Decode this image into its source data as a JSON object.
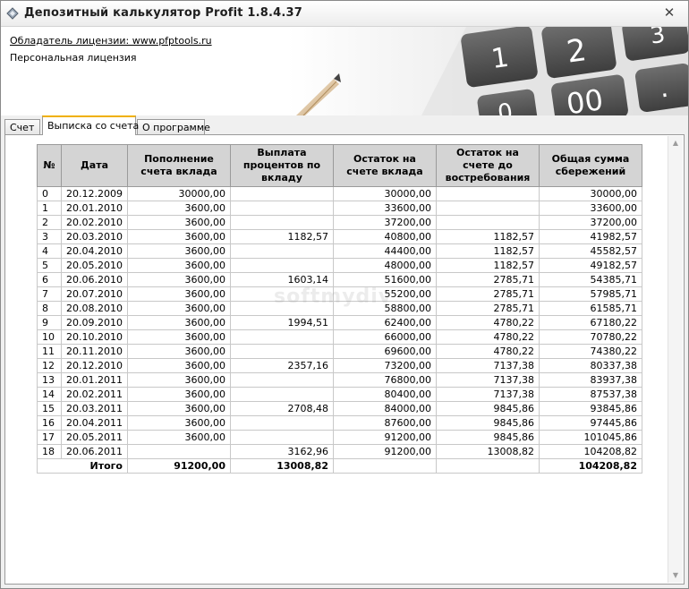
{
  "window": {
    "title": "Депозитный калькулятор Profit 1.8.4.37",
    "close_glyph": "✕"
  },
  "header": {
    "license_owner": "Обладатель лицензии: www.pfptools.ru",
    "license_type": "Персональная лицензия",
    "calc_keys": [
      "1",
      "2",
      "3",
      "0",
      "00",
      "."
    ]
  },
  "tabs": [
    {
      "label": "Счет",
      "active": false
    },
    {
      "label": "Выписка со счета",
      "active": true
    },
    {
      "label": "О программе",
      "active": false
    }
  ],
  "watermark": "softmydiv",
  "table": {
    "columns": [
      "№",
      "Дата",
      "Пополнение счета вклада",
      "Выплата процентов по вкладу",
      "Остаток на счете вклада",
      "Остаток на счете до востребования",
      "Общая сумма сбережений"
    ],
    "rows": [
      [
        "0",
        "20.12.2009",
        "30000,00",
        "",
        "30000,00",
        "",
        "30000,00"
      ],
      [
        "1",
        "20.01.2010",
        "3600,00",
        "",
        "33600,00",
        "",
        "33600,00"
      ],
      [
        "2",
        "20.02.2010",
        "3600,00",
        "",
        "37200,00",
        "",
        "37200,00"
      ],
      [
        "3",
        "20.03.2010",
        "3600,00",
        "1182,57",
        "40800,00",
        "1182,57",
        "41982,57"
      ],
      [
        "4",
        "20.04.2010",
        "3600,00",
        "",
        "44400,00",
        "1182,57",
        "45582,57"
      ],
      [
        "5",
        "20.05.2010",
        "3600,00",
        "",
        "48000,00",
        "1182,57",
        "49182,57"
      ],
      [
        "6",
        "20.06.2010",
        "3600,00",
        "1603,14",
        "51600,00",
        "2785,71",
        "54385,71"
      ],
      [
        "7",
        "20.07.2010",
        "3600,00",
        "",
        "55200,00",
        "2785,71",
        "57985,71"
      ],
      [
        "8",
        "20.08.2010",
        "3600,00",
        "",
        "58800,00",
        "2785,71",
        "61585,71"
      ],
      [
        "9",
        "20.09.2010",
        "3600,00",
        "1994,51",
        "62400,00",
        "4780,22",
        "67180,22"
      ],
      [
        "10",
        "20.10.2010",
        "3600,00",
        "",
        "66000,00",
        "4780,22",
        "70780,22"
      ],
      [
        "11",
        "20.11.2010",
        "3600,00",
        "",
        "69600,00",
        "4780,22",
        "74380,22"
      ],
      [
        "12",
        "20.12.2010",
        "3600,00",
        "2357,16",
        "73200,00",
        "7137,38",
        "80337,38"
      ],
      [
        "13",
        "20.01.2011",
        "3600,00",
        "",
        "76800,00",
        "7137,38",
        "83937,38"
      ],
      [
        "14",
        "20.02.2011",
        "3600,00",
        "",
        "80400,00",
        "7137,38",
        "87537,38"
      ],
      [
        "15",
        "20.03.2011",
        "3600,00",
        "2708,48",
        "84000,00",
        "9845,86",
        "93845,86"
      ],
      [
        "16",
        "20.04.2011",
        "3600,00",
        "",
        "87600,00",
        "9845,86",
        "97445,86"
      ],
      [
        "17",
        "20.05.2011",
        "3600,00",
        "",
        "91200,00",
        "9845,86",
        "101045,86"
      ],
      [
        "18",
        "20.06.2011",
        "",
        "3162,96",
        "91200,00",
        "13008,82",
        "104208,82"
      ]
    ],
    "total": {
      "label": "Итого",
      "deposit": "91200,00",
      "interest": "13008,82",
      "savings": "104208,82"
    }
  }
}
